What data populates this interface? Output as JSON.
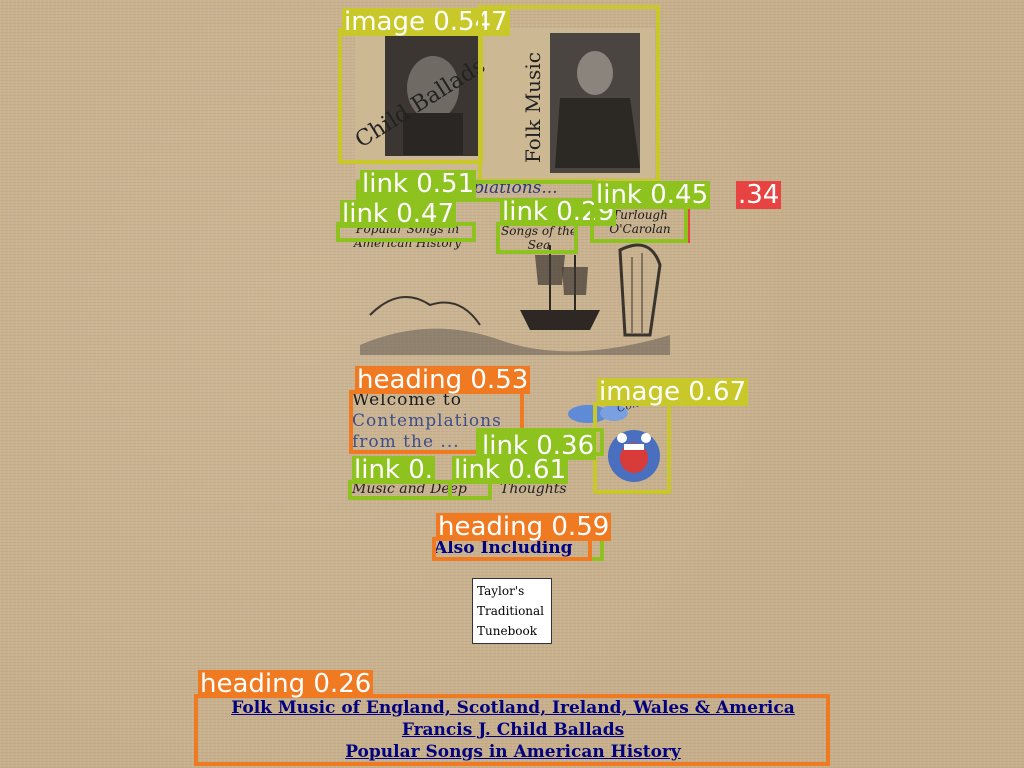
{
  "banner": {
    "child_ballads_text": "Child Ballads",
    "folk_music_text": "Folk Music",
    "url_link": "www.contemplations..."
  },
  "art_links": {
    "popular_songs": "Popular Songs in American History",
    "songs_of_sea": "Songs of the Sea",
    "carolan": "Turlough O'Carolan"
  },
  "welcome": {
    "line1": "Welcome to",
    "line2": "Contemplations",
    "line3": "from the ..."
  },
  "cartoon": {
    "label": "Contemplations"
  },
  "deep_link": {
    "part1": "Music and",
    "part2": "Deep",
    "part3": "Thoughts"
  },
  "also": {
    "heading": "Also Including"
  },
  "tunebook": {
    "line1": "Taylor's",
    "line2": "Traditional",
    "line3": "Tunebook"
  },
  "footer": {
    "link1": "Folk Music of England, Scotland, Ireland, Wales & America",
    "link2": "Francis J. Child Ballads",
    "link3": "Popular Songs in American History"
  },
  "overlays": {
    "image1": "image 0.547",
    "link_url": "link 0.51",
    "link_popular": "link 0.47",
    "link_sea": "link 0.29",
    "link_carolan": "link 0.45",
    "red_score": ".34",
    "heading_welcome": "heading 0.53",
    "image2": "image 0.67",
    "link_from": "link 0.36",
    "link_music_a": "link 0.",
    "link_music_b": "link 0.61",
    "heading_also": "heading 0.59",
    "heading_footer": "heading 0.26"
  },
  "colors": {
    "background": "#c8b08c",
    "link_blue": "#000080",
    "overlay_olive": "#c9c82a",
    "overlay_green": "#8dc21f",
    "overlay_orange": "#f07a22",
    "overlay_red": "#e84343"
  }
}
